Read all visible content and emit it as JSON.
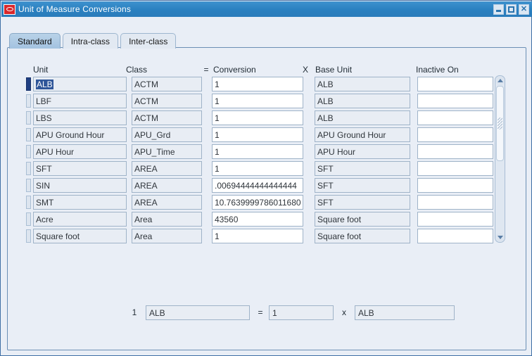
{
  "window": {
    "title": "Unit of Measure Conversions",
    "logo_icon": "oracle-logo-icon",
    "buttons": {
      "minimize": "minimize-icon",
      "maximize": "maximize-icon",
      "close": "close-icon"
    }
  },
  "tabs": [
    {
      "label": "Standard",
      "active": true
    },
    {
      "label": "Intra-class",
      "active": false
    },
    {
      "label": "Inter-class",
      "active": false
    }
  ],
  "grid": {
    "headers": {
      "unit": "Unit",
      "class": "Class",
      "equals": "=",
      "conversion": "Conversion",
      "times": "X",
      "base_unit": "Base Unit",
      "inactive_on": "Inactive On"
    },
    "rows": [
      {
        "unit": "ALB",
        "class": "ACTM",
        "conversion": "1",
        "base_unit": "ALB",
        "inactive_on": "",
        "current": true
      },
      {
        "unit": "LBF",
        "class": "ACTM",
        "conversion": "1",
        "base_unit": "ALB",
        "inactive_on": "",
        "current": false
      },
      {
        "unit": "LBS",
        "class": "ACTM",
        "conversion": "1",
        "base_unit": "ALB",
        "inactive_on": "",
        "current": false
      },
      {
        "unit": "APU Ground Hour",
        "class": "APU_Grd",
        "conversion": "1",
        "base_unit": "APU Ground Hour",
        "inactive_on": "",
        "current": false
      },
      {
        "unit": "APU Hour",
        "class": "APU_Time",
        "conversion": "1",
        "base_unit": "APU Hour",
        "inactive_on": "",
        "current": false
      },
      {
        "unit": "SFT",
        "class": "AREA",
        "conversion": "1",
        "base_unit": "SFT",
        "inactive_on": "",
        "current": false
      },
      {
        "unit": "SIN",
        "class": "AREA",
        "conversion": ".00694444444444444",
        "base_unit": "SFT",
        "inactive_on": "",
        "current": false
      },
      {
        "unit": "SMT",
        "class": "AREA",
        "conversion": "10.7639999786011680",
        "base_unit": "SFT",
        "inactive_on": "",
        "current": false
      },
      {
        "unit": "Acre",
        "class": "Area",
        "conversion": "43560",
        "base_unit": "Square foot",
        "inactive_on": "",
        "current": false
      },
      {
        "unit": "Square foot",
        "class": "Area",
        "conversion": "1",
        "base_unit": "Square foot",
        "inactive_on": "",
        "current": false
      }
    ],
    "scrollbar": {
      "up_icon": "scroll-up-arrow-icon",
      "down_icon": "scroll-down-arrow-icon",
      "grip_icon": "scroll-thumb-grip-icon"
    }
  },
  "summary": {
    "quantity": "1",
    "unit_value": "ALB",
    "equals": "=",
    "conversion_value": "1",
    "times": "x",
    "base_unit_value": "ALB"
  },
  "colors": {
    "titlebar": "#2a80c0",
    "selection": "#2f5699",
    "panel_bg": "#e9eef6",
    "field_bg": "#e8edf4",
    "field_white": "#ffffff",
    "active_tab": "#a3c2e0",
    "logo_red": "#d8272c"
  }
}
